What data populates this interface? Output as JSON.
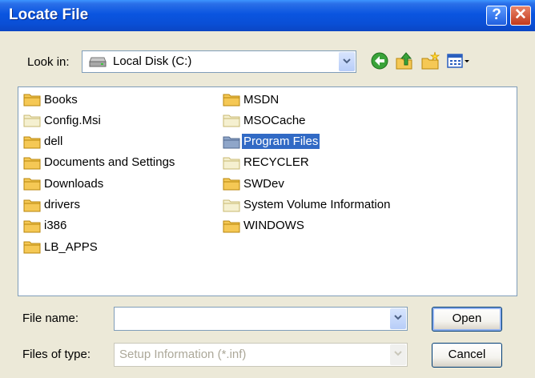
{
  "window": {
    "title": "Locate File"
  },
  "titlebar_buttons": {
    "help": "?",
    "close": "✕"
  },
  "lookin": {
    "label": "Look in:",
    "value": "Local Disk (C:)"
  },
  "toolbar": {
    "icons": [
      "back-icon",
      "up-folder-icon",
      "new-folder-icon",
      "view-menu-icon"
    ]
  },
  "files": {
    "column1": [
      "Books",
      "Config.Msi",
      "dell",
      "Documents and Settings",
      "Downloads",
      "drivers",
      "i386",
      "LB_APPS"
    ],
    "column2": [
      "MSDN",
      "MSOCache",
      "Program Files",
      "RECYCLER",
      "SWDev",
      "System Volume Information",
      "WINDOWS"
    ],
    "selected": "Program Files"
  },
  "filename": {
    "label": "File name:",
    "value": ""
  },
  "filetype": {
    "label": "Files of type:",
    "value": "Setup Information (*.inf)"
  },
  "buttons": {
    "open": "Open",
    "cancel": "Cancel"
  },
  "colors": {
    "titlebar": "#0a55e0",
    "selection": "#316ac5",
    "folder": "#f5c855"
  }
}
